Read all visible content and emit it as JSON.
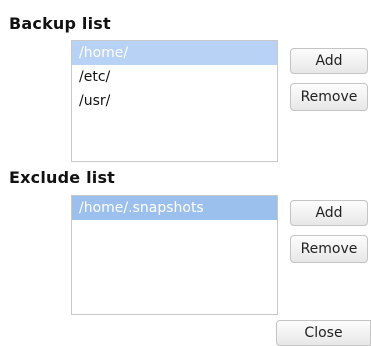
{
  "backup": {
    "title": "Backup list",
    "items": [
      "/home/",
      "/etc/",
      "/usr/"
    ],
    "add_label": "Add",
    "remove_label": "Remove"
  },
  "exclude": {
    "title": "Exclude list",
    "items": [
      "/home/.snapshots"
    ],
    "add_label": "Add",
    "remove_label": "Remove"
  },
  "footer": {
    "close_label": "Close"
  },
  "colors": {
    "selection_backup": "#b7d2f4",
    "selection_exclude": "#9cc0ee"
  }
}
